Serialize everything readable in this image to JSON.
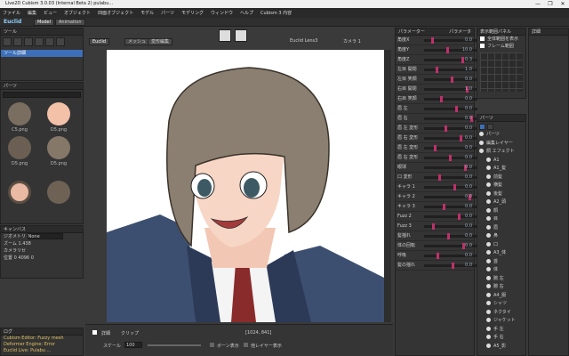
{
  "title": "Live2D Cubism 3.0.03 (Internal Beta 2) pulabu...",
  "brand": "Euclid",
  "brand_tabs": [
    "Model",
    "Animation"
  ],
  "window_buttons": [
    "—",
    "❐",
    "✕"
  ],
  "menu": [
    "ファイル",
    "編集",
    "ビュー",
    "オブジェクト",
    "四面オブジェクト",
    "モデル",
    "パーツ",
    "モデリング",
    "ウィンドウ",
    "ヘルプ",
    "Cubism 3 内容"
  ],
  "left": {
    "tool_title": "ツール",
    "tool_row": "ツール詳細",
    "parts_title": "パーツ",
    "thumbs": [
      "C5.png",
      "D5.png",
      "D5.png",
      "D5.png",
      "",
      ""
    ],
    "canvas_title": "キャンバス",
    "canvas_rows": [
      [
        "ジオメトリ",
        "None"
      ],
      [
        "ズーム",
        "1.438"
      ],
      [
        "カメラリセ",
        ""
      ],
      [
        "位置",
        "0",
        "4096",
        "0"
      ]
    ],
    "log_title": "ログ",
    "log_lines": [
      "Cubism Editor: Fuzzy mesh",
      "Deformer Engine: Error",
      "Euclid Live: Pulabu ..."
    ]
  },
  "toolbar": {
    "mode": "Euclid",
    "tabs": [
      "メッシュ",
      "変形編集"
    ],
    "euclid_label": "Euclid Lens3",
    "camera_label": "カメラ 1"
  },
  "bottom": {
    "zoom_label": "スケール",
    "zoom_value": "100",
    "option_a": "ボーン表示",
    "option_b": "他レイヤー表示",
    "frames": [
      "詳細",
      "クリップ"
    ],
    "coords": "[1024, 841]"
  },
  "params": {
    "title": "パラメーター",
    "header_right": "パラメータ",
    "rows": [
      "角度X",
      "角度Y",
      "角度Z",
      "左目 開閉",
      "左目 笑顔",
      "右目 開閉",
      "右目 笑顔",
      "眉 左",
      "眉 右",
      "眉 左 変形",
      "眉 右 変形",
      "眉 左 変形",
      "眉 右 変形",
      "眼球",
      "口 変形",
      "キャラ 1",
      "キャラ 2",
      "キャラ 3",
      "Fuzz 2",
      "Fuzz 3",
      "髪揺れ",
      "体の回転",
      "呼吸",
      "髪の揺れ"
    ],
    "values": [
      "0.0",
      "10.0",
      "0.3",
      "1.0",
      "0.0",
      "1.0",
      "0.0",
      "0.0",
      "0.0",
      "0.0",
      "0.0",
      "0.0",
      "0.0",
      "0.0",
      "0.0",
      "0.0",
      "0.0",
      "0.0",
      "0.0",
      "0.0",
      "0.0",
      "0.0",
      "0.0",
      "0.0"
    ]
  },
  "preview": {
    "title": "表示範囲パネル",
    "options": [
      "全体範囲を表示",
      "フレーム範囲"
    ]
  },
  "details": {
    "title": "詳細"
  },
  "parts": {
    "title": "パーツ",
    "items": [
      "パーツ",
      "編集レイヤー",
      "顔 エフェクト",
      "A1",
      "A1_髪",
      "前髪",
      "横髪",
      "後髪",
      "A2_頭",
      "顔",
      "目",
      "眉",
      "鼻",
      "口",
      "A3_体",
      "首",
      "体",
      "腕 左",
      "腕 右",
      "A4_服",
      "シャツ",
      "ネクタイ",
      "ジャケット",
      "手 左",
      "手 右",
      "A5_影"
    ]
  },
  "colors": {
    "accent": "#3d6fb8",
    "canvas": "#ffffff",
    "hair": "#8a7f70",
    "jacket": "#3d4f70"
  }
}
